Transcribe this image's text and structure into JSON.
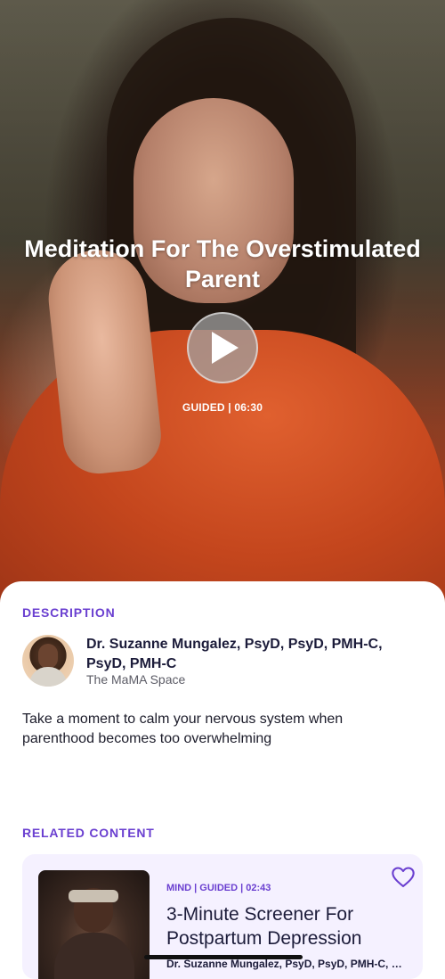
{
  "hero": {
    "title": "Meditation For The Overstimulated Parent",
    "meta": "GUIDED | 06:30"
  },
  "description": {
    "label": "DESCRIPTION",
    "author_name": "Dr. Suzanne Mungalez, PsyD, PsyD, PMH-C, PsyD, PMH-C",
    "author_org": "The MaMA Space",
    "text": "Take a moment to calm your nervous system when parenthood becomes too overwhelming"
  },
  "related": {
    "label": "RELATED CONTENT",
    "items": [
      {
        "meta": "MIND | GUIDED | 02:43",
        "title": "3-Minute Screener For Postpartum Depression",
        "author": "Dr. Suzanne Mungalez, PsyD, PsyD, PMH-C, PsyD, PMH-C"
      }
    ]
  },
  "colors": {
    "accent": "#6a3fd0",
    "card_bg": "#f5f1ff",
    "text_dark": "#1c1c3a"
  },
  "icons": {
    "play": "play-icon",
    "favorite": "heart-outline-icon"
  }
}
